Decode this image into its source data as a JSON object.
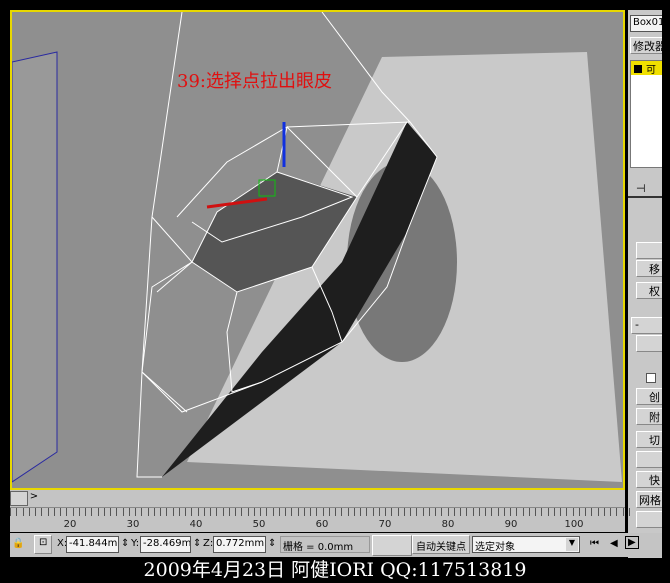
{
  "viewport": {
    "annotation": "39:选择点拉出眼皮",
    "border_color": "#e8d800"
  },
  "panel": {
    "object_name": "Box01",
    "modifier_list": "修改器",
    "stack_item": "可",
    "buttons": [
      "",
      "移",
      "权",
      "-",
      "",
      "创",
      "附",
      "切",
      "",
      "快",
      "网格",
      ""
    ]
  },
  "timeline": {
    "next_label": ">",
    "ticks": [
      "20",
      "30",
      "40",
      "50",
      "60",
      "70",
      "80",
      "90",
      "100"
    ]
  },
  "status": {
    "x_label": "X:",
    "x_value": "-41.844mm",
    "y_label": "Y:",
    "y_value": "-28.469mm",
    "z_label": "Z:",
    "z_value": "0.772mm",
    "grid_text": "栅格 = 0.0mm",
    "auto_key": "自动关键点",
    "selection_dropdown": "选定对象"
  },
  "caption": "2009年4月23日  阿健IORI QQ:117513819"
}
